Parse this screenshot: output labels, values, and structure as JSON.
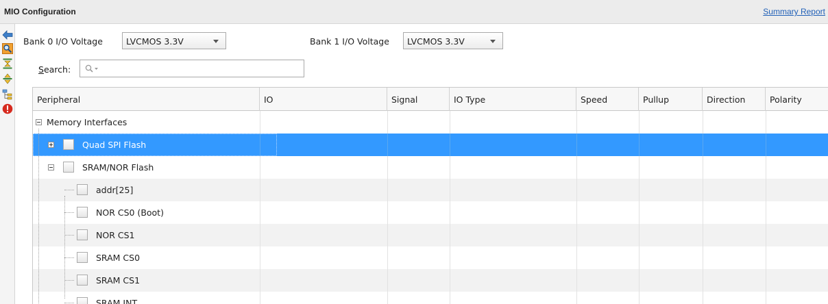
{
  "panel": {
    "title": "MIO Configuration",
    "summary_link": "Summary Report"
  },
  "toolbar": {
    "icons": [
      "back-arrow-icon",
      "search-icon",
      "collapse-all-icon",
      "expand-all-icon",
      "tree-view-icon",
      "error-icon"
    ]
  },
  "bank0": {
    "label_pre": "Bank 0 ",
    "label_io": "I/O",
    "label_post": " Voltage",
    "value": "LVCMOS 3.3V"
  },
  "bank1": {
    "label_pre": "Bank 1 ",
    "label_io": "I/O",
    "label_post": " Voltage",
    "value": "LVCMOS 3.3V"
  },
  "search": {
    "label_underlined": "S",
    "label_rest": "earch:",
    "placeholder": "Q-"
  },
  "table": {
    "columns": [
      "Peripheral",
      "IO",
      "Signal",
      "IO Type",
      "Speed",
      "Pullup",
      "Direction",
      "Polarity"
    ],
    "rows": [
      {
        "label": "Memory Interfaces",
        "level": 0,
        "expander": "minus",
        "checkbox": false,
        "selected": false
      },
      {
        "label": "Quad SPI Flash",
        "level": 1,
        "expander": "plus",
        "checkbox": true,
        "selected": true
      },
      {
        "label": "SRAM/NOR Flash",
        "level": 1,
        "expander": "minus",
        "checkbox": true,
        "selected": false
      },
      {
        "label": "addr[25]",
        "level": 2,
        "expander": "",
        "checkbox": true,
        "selected": false
      },
      {
        "label": "NOR CS0 (Boot)",
        "level": 2,
        "expander": "",
        "checkbox": true,
        "selected": false
      },
      {
        "label": "NOR CS1",
        "level": 2,
        "expander": "",
        "checkbox": true,
        "selected": false
      },
      {
        "label": "SRAM CS0",
        "level": 2,
        "expander": "",
        "checkbox": true,
        "selected": false
      },
      {
        "label": "SRAM CS1",
        "level": 2,
        "expander": "",
        "checkbox": true,
        "selected": false
      },
      {
        "label": "SRAM INT",
        "level": 2,
        "expander": "",
        "checkbox": true,
        "selected": false
      }
    ]
  },
  "colors": {
    "selection": "#3399ff",
    "link": "#1f5fb7",
    "error": "#d62b1f"
  }
}
